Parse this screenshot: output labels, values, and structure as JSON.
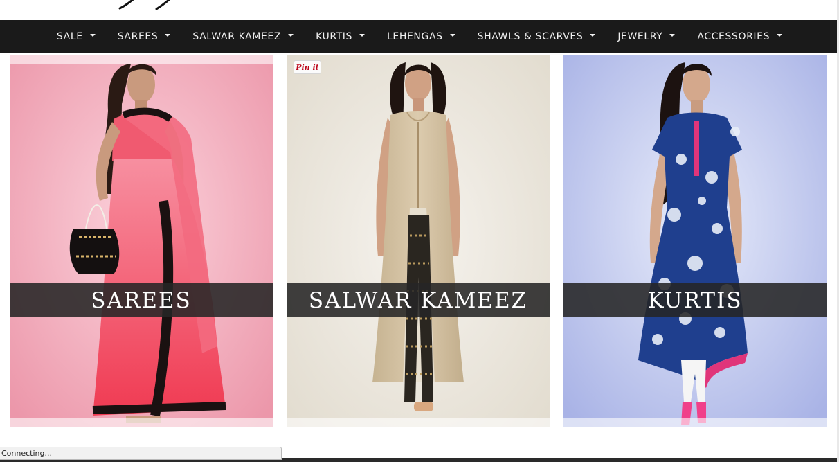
{
  "colors": {
    "nav_bg": "#1a1a1a",
    "nav_text": "#f2f2f2",
    "label_overlay": "#262626",
    "pinterest_red": "#bd081c",
    "saree_bg": "#f2a9b8",
    "saree_drape": "#f2405a",
    "salwar_bg": "#ece7dc",
    "salwar_kameez": "#d2c1a2",
    "kurti_bg": "#b7c2ea",
    "kurti_dress": "#1f3f8e"
  },
  "nav": {
    "items": [
      {
        "label": "SALE",
        "icon": "caret-down-icon"
      },
      {
        "label": "SAREES",
        "icon": "caret-down-icon"
      },
      {
        "label": "SALWAR KAMEEZ",
        "icon": "caret-down-icon"
      },
      {
        "label": "KURTIS",
        "icon": "caret-down-icon"
      },
      {
        "label": "LEHENGAS",
        "icon": "caret-down-icon"
      },
      {
        "label": "SHAWLS & SCARVES",
        "icon": "caret-down-icon"
      },
      {
        "label": "JEWELRY",
        "icon": "caret-down-icon"
      },
      {
        "label": "ACCESSORIES",
        "icon": "caret-down-icon"
      }
    ]
  },
  "tiles": {
    "sarees": {
      "label": "SAREES"
    },
    "salwar": {
      "label": "SALWAR KAMEEZ",
      "pin_label": "Pin it"
    },
    "kurtis": {
      "label": "KURTIS"
    }
  },
  "status": {
    "text": "Connecting..."
  }
}
